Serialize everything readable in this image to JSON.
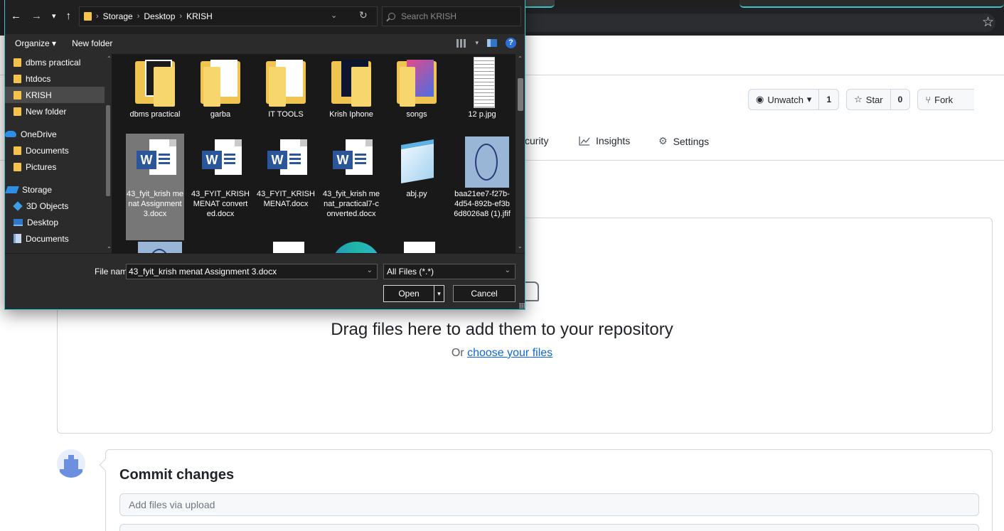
{
  "browser": {
    "bookmark_icon": "star-icon"
  },
  "repo": {
    "unwatch_label": "Unwatch",
    "unwatch_count": "1",
    "star_label": "Star",
    "star_count": "0",
    "fork_label": "Fork",
    "nav": [
      {
        "label": "curity"
      },
      {
        "label": "Insights",
        "icon": "graph-icon"
      },
      {
        "label": "Settings",
        "icon": "gear-icon"
      }
    ]
  },
  "upload": {
    "drop_title": "Drag files here to add them to your repository",
    "drop_prefix": "Or",
    "choose_link": "choose your files",
    "commit_title": "Commit changes",
    "commit_placeholder": "Add files via upload"
  },
  "dialog": {
    "breadcrumb": [
      "Storage",
      "Desktop",
      "KRISH"
    ],
    "search_placeholder": "Search KRISH",
    "organize_label": "Organize",
    "new_folder_label": "New folder",
    "nav_items": [
      {
        "label": "dbms practical",
        "icon": "folder-icon"
      },
      {
        "label": "htdocs",
        "icon": "folder-icon"
      },
      {
        "label": "KRISH",
        "icon": "folder-icon",
        "selected": true
      },
      {
        "label": "New folder",
        "icon": "folder-icon"
      },
      {
        "label": "OneDrive",
        "icon": "cloud-icon"
      },
      {
        "label": "Documents",
        "icon": "folder-icon"
      },
      {
        "label": "Pictures",
        "icon": "folder-icon"
      },
      {
        "label": "Storage",
        "icon": "drive-icon"
      },
      {
        "label": "3D Objects",
        "icon": "cube-icon"
      },
      {
        "label": "Desktop",
        "icon": "desktop-icon"
      },
      {
        "label": "Documents",
        "icon": "document-icon"
      }
    ],
    "files": [
      {
        "name": "dbms practical",
        "type": "folder"
      },
      {
        "name": "garba",
        "type": "folder"
      },
      {
        "name": "IT TOOLS",
        "type": "folder"
      },
      {
        "name": "Krish Iphone",
        "type": "folder"
      },
      {
        "name": "songs",
        "type": "folder"
      },
      {
        "name": "12 p.jpg",
        "type": "image"
      },
      {
        "name": "43_fyit_krish menat Assignment 3.docx",
        "type": "word",
        "selected": true
      },
      {
        "name": "43_FYIT_KRISH MENAT converted.docx",
        "type": "word"
      },
      {
        "name": "43_FYIT_KRISH MENAT.docx",
        "type": "word"
      },
      {
        "name": "43_fyit_krish menat_practical7-converted.docx",
        "type": "word"
      },
      {
        "name": "abj.py",
        "type": "python"
      },
      {
        "name": "baa21ee7-f27b-4d54-892b-ef3b6d8026a8 (1).jfif",
        "type": "image"
      }
    ],
    "file_name_label": "File name:",
    "file_name_value": "43_fyit_krish menat Assignment 3.docx",
    "file_type_value": "All Files (*.*)",
    "open_label": "Open",
    "cancel_label": "Cancel"
  }
}
